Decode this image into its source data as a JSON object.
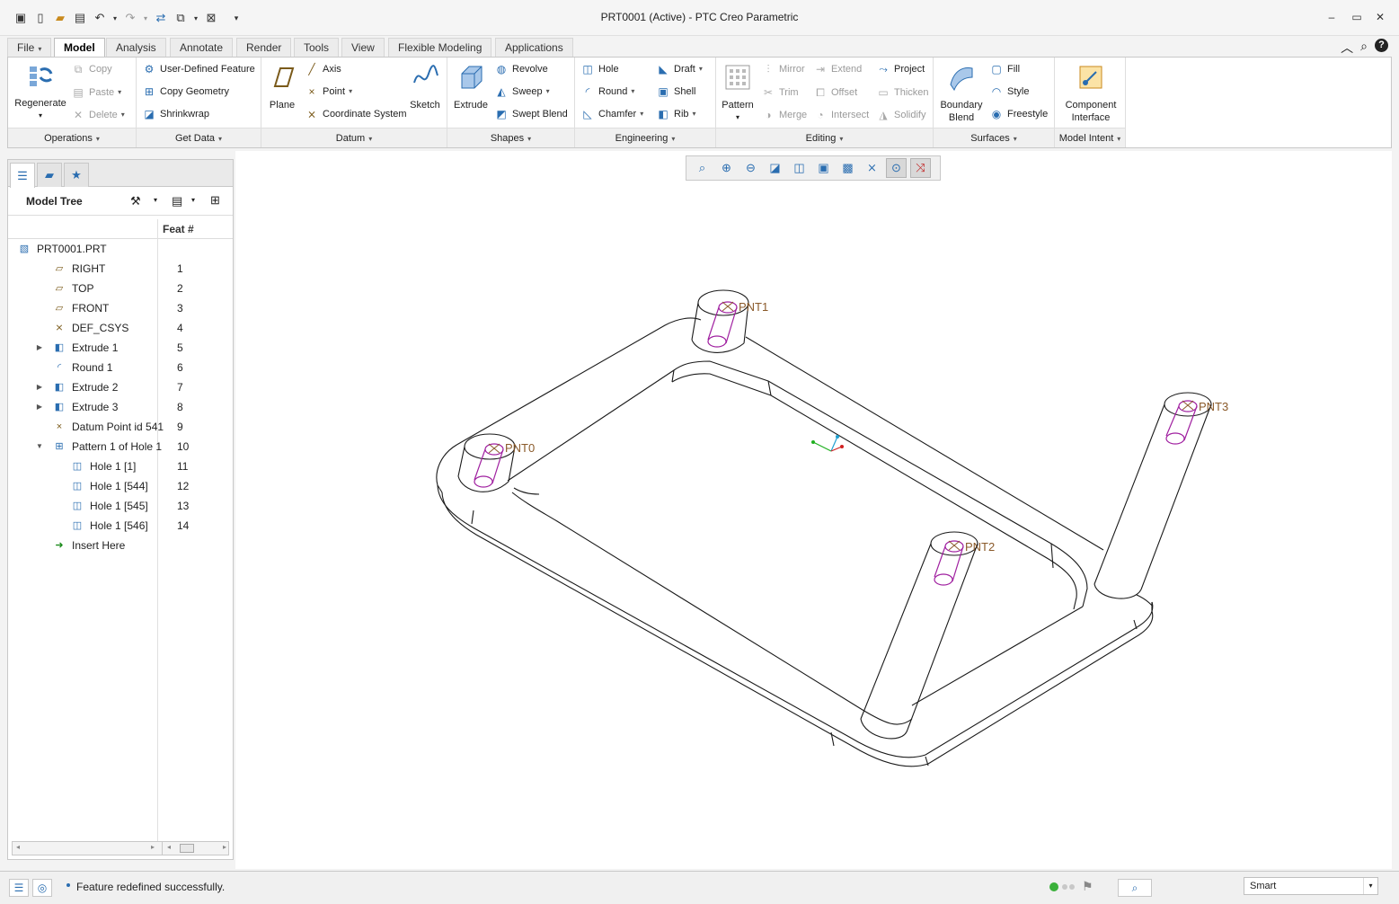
{
  "window": {
    "title": "PRT0001 (Active) - PTC Creo Parametric"
  },
  "quick_access": [
    "app-icon",
    "new-icon",
    "open-icon",
    "save-icon",
    "undo-icon",
    "redo-icon",
    "regenerate-icon",
    "windows-icon",
    "close-window-icon",
    "customize-icon"
  ],
  "tabs": [
    {
      "label": "File",
      "caret": "▾"
    },
    {
      "label": "Model"
    },
    {
      "label": "Analysis"
    },
    {
      "label": "Annotate"
    },
    {
      "label": "Render"
    },
    {
      "label": "Tools"
    },
    {
      "label": "View"
    },
    {
      "label": "Flexible Modeling"
    },
    {
      "label": "Applications"
    }
  ],
  "ribbon": {
    "operations": {
      "label": "Operations",
      "regenerate": "Regenerate",
      "copy": "Copy",
      "paste": "Paste",
      "delete": "Delete"
    },
    "get_data": {
      "label": "Get Data",
      "udf": "User-Defined Feature",
      "copy_geometry": "Copy Geometry",
      "shrinkwrap": "Shrinkwrap"
    },
    "datum": {
      "label": "Datum",
      "plane": "Plane",
      "axis": "Axis",
      "point": "Point",
      "csys": "Coordinate System",
      "sketch": "Sketch"
    },
    "shapes": {
      "label": "Shapes",
      "extrude": "Extrude",
      "revolve": "Revolve",
      "sweep": "Sweep",
      "swept_blend": "Swept Blend"
    },
    "engineering": {
      "label": "Engineering",
      "hole": "Hole",
      "round": "Round",
      "chamfer": "Chamfer",
      "draft": "Draft",
      "shell": "Shell",
      "rib": "Rib"
    },
    "editing": {
      "label": "Editing",
      "pattern": "Pattern",
      "mirror": "Mirror",
      "trim": "Trim",
      "merge": "Merge",
      "extend": "Extend",
      "offset": "Offset",
      "intersect": "Intersect",
      "project": "Project",
      "thicken": "Thicken",
      "solidify": "Solidify"
    },
    "surfaces": {
      "label": "Surfaces",
      "boundary_blend_1": "Boundary",
      "boundary_blend_2": "Blend",
      "fill": "Fill",
      "style": "Style",
      "freestyle": "Freestyle"
    },
    "model_intent": {
      "label": "Model Intent",
      "component_interface_1": "Component",
      "component_interface_2": "Interface"
    }
  },
  "model_tree": {
    "title": "Model Tree",
    "col_feat": "Feat #",
    "rows": [
      {
        "label": "PRT0001.PRT",
        "feat": "",
        "icon": "part-icon",
        "indent": 0,
        "expander": ""
      },
      {
        "label": "RIGHT",
        "feat": "1",
        "icon": "datum-plane-icon",
        "indent": 1,
        "expander": ""
      },
      {
        "label": "TOP",
        "feat": "2",
        "icon": "datum-plane-icon",
        "indent": 1,
        "expander": ""
      },
      {
        "label": "FRONT",
        "feat": "3",
        "icon": "datum-plane-icon",
        "indent": 1,
        "expander": ""
      },
      {
        "label": "DEF_CSYS",
        "feat": "4",
        "icon": "csys-icon",
        "indent": 1,
        "expander": ""
      },
      {
        "label": "Extrude 1",
        "feat": "5",
        "icon": "extrude-icon",
        "indent": 1,
        "expander": "▶"
      },
      {
        "label": "Round 1",
        "feat": "6",
        "icon": "round-icon",
        "indent": 1,
        "expander": ""
      },
      {
        "label": "Extrude 2",
        "feat": "7",
        "icon": "extrude-icon",
        "indent": 1,
        "expander": "▶"
      },
      {
        "label": "Extrude 3",
        "feat": "8",
        "icon": "extrude-icon",
        "indent": 1,
        "expander": "▶"
      },
      {
        "label": "Datum Point id 541",
        "feat": "9",
        "icon": "datum-point-icon",
        "indent": 1,
        "expander": ""
      },
      {
        "label": "Pattern 1 of Hole 1",
        "feat": "10",
        "icon": "pattern-icon",
        "indent": 1,
        "expander": "▼"
      },
      {
        "label": "Hole 1 [1]",
        "feat": "11",
        "icon": "hole-icon",
        "indent": 2,
        "expander": ""
      },
      {
        "label": "Hole 1 [544]",
        "feat": "12",
        "icon": "hole-icon",
        "indent": 2,
        "expander": ""
      },
      {
        "label": "Hole 1 [545]",
        "feat": "13",
        "icon": "hole-icon",
        "indent": 2,
        "expander": ""
      },
      {
        "label": "Hole 1 [546]",
        "feat": "14",
        "icon": "hole-icon",
        "indent": 2,
        "expander": ""
      },
      {
        "label": "Insert Here",
        "feat": "",
        "icon": "insert-arrow-icon",
        "indent": 1,
        "expander": ""
      }
    ]
  },
  "viewport": {
    "point_labels": [
      "PNT0",
      "PNT1",
      "PNT2",
      "PNT3"
    ],
    "colors": {
      "edge": "#1a1a1a",
      "hole": "#a020a0",
      "label": "#8a5a2a"
    }
  },
  "status": {
    "message": "Feature redefined successfully.",
    "filter": "Smart"
  }
}
